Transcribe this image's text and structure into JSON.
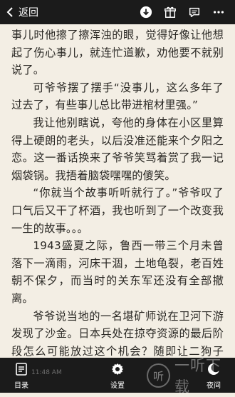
{
  "topbar": {
    "back_label": "返回",
    "icons": [
      "download-icon",
      "gift-icon",
      "message-icon",
      "more-icon"
    ]
  },
  "content": {
    "paragraphs": [
      "事儿时他擦了擦浑浊的眼，觉得好像让他想起了伤心事儿，就连忙道歉，劝他要不就别说了。",
      "可爷爷摆了摆手“没事儿，这么多年了过去了，有些事儿总比带进棺材里强。”",
      "我让他别瞎说，夸他的身体在小区里算得上硬朗的老头，以后没准还能来个夕阳之恋。这一番话换来了爷爷笑骂着赏了我一记烟袋锅。我捂着脑袋嘿嘿的傻笑。",
      "“你就当个故事听听就行了。”爷爷叹了口气后又干了杯酒，我也听到了一个改变我一生的故事。。。",
      "1943盛夏之际，鲁西一带三个月未曾落下一滴雨，河床干涸，土地龟裂，老百姓朝不保夕，而当时的关东军还没有全部撤离。",
      "爷爷说当地的一名堪矿师说在卫河下游发现了沙金。日本兵处在掠夺资源的最后阶段怎么可能放过这个机会？随即让二狗子（汉奸）以一天九个窝窝头的工钱去村里找劳力。这对于当时久旱的鲁西"
    ]
  },
  "bottombar": {
    "catalog_label": "目录",
    "settings_label": "设置",
    "night_label": "夜间",
    "time": "11:48 AM",
    "watermark_text": "一听下载",
    "watermark_glyph": "听"
  }
}
